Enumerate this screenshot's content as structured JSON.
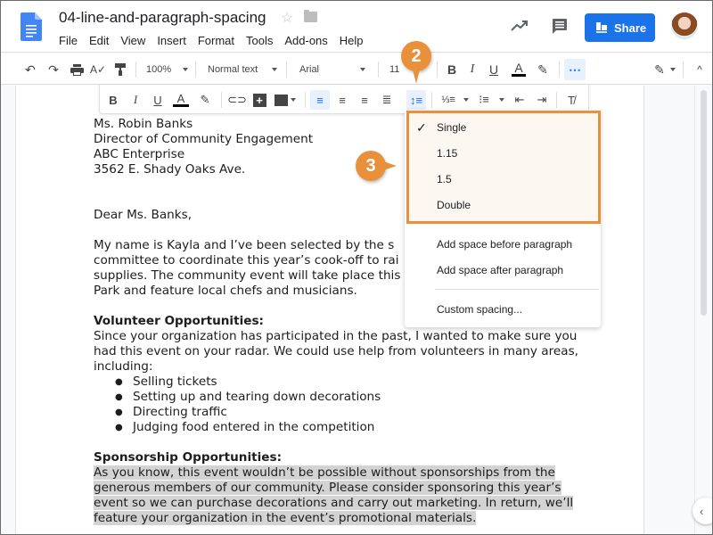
{
  "header": {
    "title": "04-line-and-paragraph-spacing",
    "menu": [
      "File",
      "Edit",
      "View",
      "Insert",
      "Format",
      "Tools",
      "Add-ons",
      "Help"
    ],
    "share_label": "Share"
  },
  "toolbar": {
    "zoom": "100%",
    "style": "Normal text",
    "font": "Arial",
    "size": "11"
  },
  "callouts": {
    "step2": "2",
    "step3": "3"
  },
  "spacing_menu": {
    "selected": "Single",
    "options": [
      "Single",
      "1.15",
      "1.5",
      "Double"
    ],
    "add_before": "Add space before paragraph",
    "add_after": "Add space after paragraph",
    "custom": "Custom spacing..."
  },
  "document": {
    "address": [
      "Ms. Robin Banks",
      "Director of Community Engagement",
      "ABC Enterprise",
      "3562 E. Shady Oaks Ave."
    ],
    "salutation": "Dear Ms. Banks,",
    "intro": [
      "My name is Kayla and I’ve been selected by the s",
      "committee to coordinate this year’s cook-off to rai",
      "supplies. The community event will take place this",
      "Park and feature local chefs and musicians."
    ],
    "volunteer_heading": "Volunteer Opportunities:",
    "volunteer_text": [
      "Since your organization has participated in the past, I wanted to make sure you",
      "had this event on your radar. We could use help from volunteers in many areas,",
      "including:"
    ],
    "volunteer_items": [
      "Selling tickets",
      "Setting up and tearing down decorations",
      "Directing traffic",
      "Judging food entered in the competition"
    ],
    "sponsor_heading": "Sponsorship Opportunities:",
    "sponsor_text": [
      "As you know, this event wouldn’t be possible without sponsorships from the",
      "generous members of our community. Please consider sponsoring this year’s",
      "event so we can purchase decorations and carry out marketing. In return, we’ll",
      "feature your organization in the event’s promotional materials."
    ]
  },
  "colors": {
    "accent": "#1a73e8",
    "callout": "#e8903a",
    "highlight": "#d3d3d3"
  }
}
